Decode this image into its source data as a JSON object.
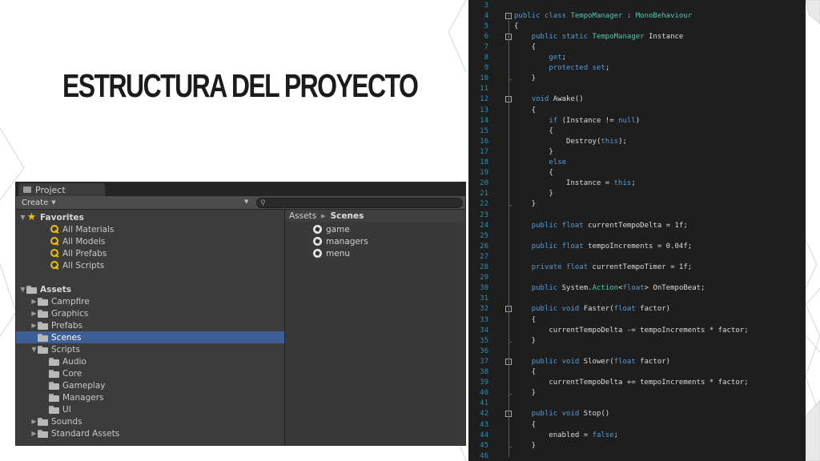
{
  "slide": {
    "title": "ESTRUCTURA DEL PROYECTO"
  },
  "project_window": {
    "tab_label": "Project",
    "create_label": "Create",
    "search_placeholder": "",
    "tree": [
      {
        "label": "Favorites",
        "kind": "header-star",
        "indent": 0,
        "expanded": true
      },
      {
        "label": "All Materials",
        "kind": "search",
        "indent": 2
      },
      {
        "label": "All Models",
        "kind": "search",
        "indent": 2
      },
      {
        "label": "All Prefabs",
        "kind": "search",
        "indent": 2
      },
      {
        "label": "All Scripts",
        "kind": "search",
        "indent": 2
      },
      {
        "label": "",
        "kind": "spacer"
      },
      {
        "label": "Assets",
        "kind": "header-folder",
        "indent": 0,
        "expanded": true
      },
      {
        "label": "Campfire",
        "kind": "folder",
        "indent": 1,
        "expandable": true
      },
      {
        "label": "Graphics",
        "kind": "folder",
        "indent": 1,
        "expandable": true
      },
      {
        "label": "Prefabs",
        "kind": "folder",
        "indent": 1,
        "expandable": true
      },
      {
        "label": "Scenes",
        "kind": "folder",
        "indent": 1,
        "selected": true
      },
      {
        "label": "Scripts",
        "kind": "folder",
        "indent": 1,
        "expanded": true
      },
      {
        "label": "Audio",
        "kind": "folder",
        "indent": 2
      },
      {
        "label": "Core",
        "kind": "folder",
        "indent": 2
      },
      {
        "label": "Gameplay",
        "kind": "folder",
        "indent": 2
      },
      {
        "label": "Managers",
        "kind": "folder",
        "indent": 2
      },
      {
        "label": "UI",
        "kind": "folder",
        "indent": 2
      },
      {
        "label": "Sounds",
        "kind": "folder",
        "indent": 1,
        "expandable": true
      },
      {
        "label": "Standard Assets",
        "kind": "folder",
        "indent": 1,
        "expandable": true
      }
    ],
    "breadcrumb": {
      "root": "Assets",
      "current": "Scenes"
    },
    "scenes": [
      "game",
      "managers",
      "menu"
    ]
  },
  "code_editor": {
    "lines": [
      {
        "n": "3",
        "t": []
      },
      {
        "n": "4",
        "fold": "-",
        "t": [
          [
            "k",
            "public class "
          ],
          [
            "t",
            "TempoManager"
          ],
          [
            "p",
            " : "
          ],
          [
            "t",
            "MonoBehaviour"
          ]
        ]
      },
      {
        "n": "5",
        "t": [
          [
            "p",
            "{"
          ]
        ]
      },
      {
        "n": "6",
        "fold": "-",
        "t": [
          [
            "p",
            "    "
          ],
          [
            "k",
            "public static "
          ],
          [
            "t",
            "TempoManager"
          ],
          [
            "p",
            " Instance"
          ]
        ]
      },
      {
        "n": "7",
        "t": [
          [
            "p",
            "    {"
          ]
        ]
      },
      {
        "n": "8",
        "t": [
          [
            "p",
            "        "
          ],
          [
            "k",
            "get"
          ],
          [
            "p",
            ";"
          ]
        ]
      },
      {
        "n": "9",
        "t": [
          [
            "p",
            "        "
          ],
          [
            "k",
            "protected set"
          ],
          [
            "p",
            ";"
          ]
        ]
      },
      {
        "n": "10",
        "t": [
          [
            "p",
            "    }"
          ]
        ]
      },
      {
        "n": "11",
        "t": []
      },
      {
        "n": "12",
        "fold": "-",
        "t": [
          [
            "p",
            "    "
          ],
          [
            "k",
            "void"
          ],
          [
            "p",
            " Awake()"
          ]
        ]
      },
      {
        "n": "13",
        "t": [
          [
            "p",
            "    {"
          ]
        ]
      },
      {
        "n": "14",
        "t": [
          [
            "p",
            "        "
          ],
          [
            "k",
            "if"
          ],
          [
            "p",
            " (Instance != "
          ],
          [
            "k",
            "null"
          ],
          [
            "p",
            ")"
          ]
        ]
      },
      {
        "n": "15",
        "t": [
          [
            "p",
            "        {"
          ]
        ]
      },
      {
        "n": "16",
        "t": [
          [
            "p",
            "            Destroy("
          ],
          [
            "k",
            "this"
          ],
          [
            "p",
            ");"
          ]
        ]
      },
      {
        "n": "17",
        "t": [
          [
            "p",
            "        }"
          ]
        ]
      },
      {
        "n": "18",
        "t": [
          [
            "p",
            "        "
          ],
          [
            "k",
            "else"
          ]
        ]
      },
      {
        "n": "19",
        "t": [
          [
            "p",
            "        {"
          ]
        ]
      },
      {
        "n": "20",
        "t": [
          [
            "p",
            "            Instance = "
          ],
          [
            "k",
            "this"
          ],
          [
            "p",
            ";"
          ]
        ]
      },
      {
        "n": "21",
        "t": [
          [
            "p",
            "        }"
          ]
        ]
      },
      {
        "n": "22",
        "t": [
          [
            "p",
            "    }"
          ]
        ]
      },
      {
        "n": "23",
        "t": []
      },
      {
        "n": "24",
        "t": [
          [
            "p",
            "    "
          ],
          [
            "k",
            "public float"
          ],
          [
            "p",
            " currentTempoDelta = 1f;"
          ]
        ]
      },
      {
        "n": "25",
        "t": []
      },
      {
        "n": "26",
        "t": [
          [
            "p",
            "    "
          ],
          [
            "k",
            "public float"
          ],
          [
            "p",
            " tempoIncrements = 0.04f;"
          ]
        ]
      },
      {
        "n": "27",
        "t": []
      },
      {
        "n": "28",
        "t": [
          [
            "p",
            "    "
          ],
          [
            "k",
            "private float"
          ],
          [
            "p",
            " currentTempoTimer = 1f;"
          ]
        ]
      },
      {
        "n": "29",
        "t": []
      },
      {
        "n": "30",
        "t": [
          [
            "p",
            "    "
          ],
          [
            "k",
            "public"
          ],
          [
            "p",
            " System."
          ],
          [
            "t",
            "Action"
          ],
          [
            "p",
            "<"
          ],
          [
            "k",
            "float"
          ],
          [
            "p",
            "> OnTempoBeat;"
          ]
        ]
      },
      {
        "n": "31",
        "t": []
      },
      {
        "n": "32",
        "fold": "-",
        "t": [
          [
            "p",
            "    "
          ],
          [
            "k",
            "public void"
          ],
          [
            "p",
            " Faster("
          ],
          [
            "k",
            "float"
          ],
          [
            "p",
            " factor)"
          ]
        ]
      },
      {
        "n": "33",
        "t": [
          [
            "p",
            "    {"
          ]
        ]
      },
      {
        "n": "34",
        "t": [
          [
            "p",
            "        currentTempoDelta -= tempoIncrements * factor;"
          ]
        ]
      },
      {
        "n": "35",
        "t": [
          [
            "p",
            "    }"
          ]
        ]
      },
      {
        "n": "36",
        "t": []
      },
      {
        "n": "37",
        "fold": "-",
        "t": [
          [
            "p",
            "    "
          ],
          [
            "k",
            "public void"
          ],
          [
            "p",
            " Slower("
          ],
          [
            "k",
            "float"
          ],
          [
            "p",
            " factor)"
          ]
        ]
      },
      {
        "n": "38",
        "t": [
          [
            "p",
            "    {"
          ]
        ]
      },
      {
        "n": "39",
        "t": [
          [
            "p",
            "        currentTempoDelta += tempoIncrements * factor;"
          ]
        ]
      },
      {
        "n": "40",
        "t": [
          [
            "p",
            "    }"
          ]
        ]
      },
      {
        "n": "41",
        "t": []
      },
      {
        "n": "42",
        "fold": "-",
        "t": [
          [
            "p",
            "    "
          ],
          [
            "k",
            "public void"
          ],
          [
            "p",
            " Stop()"
          ]
        ]
      },
      {
        "n": "43",
        "t": [
          [
            "p",
            "    {"
          ]
        ]
      },
      {
        "n": "44",
        "t": [
          [
            "p",
            "        enabled = "
          ],
          [
            "k",
            "false"
          ],
          [
            "p",
            ";"
          ]
        ]
      },
      {
        "n": "45",
        "t": [
          [
            "p",
            "    }"
          ]
        ]
      },
      {
        "n": "46",
        "t": []
      }
    ]
  },
  "colors": {
    "keyword": "#569cd6",
    "type": "#4ec9b0",
    "plain": "#dcdcdc",
    "line_number": "#2b91af",
    "selection": "#3e5f96",
    "star": "#f0c000"
  }
}
